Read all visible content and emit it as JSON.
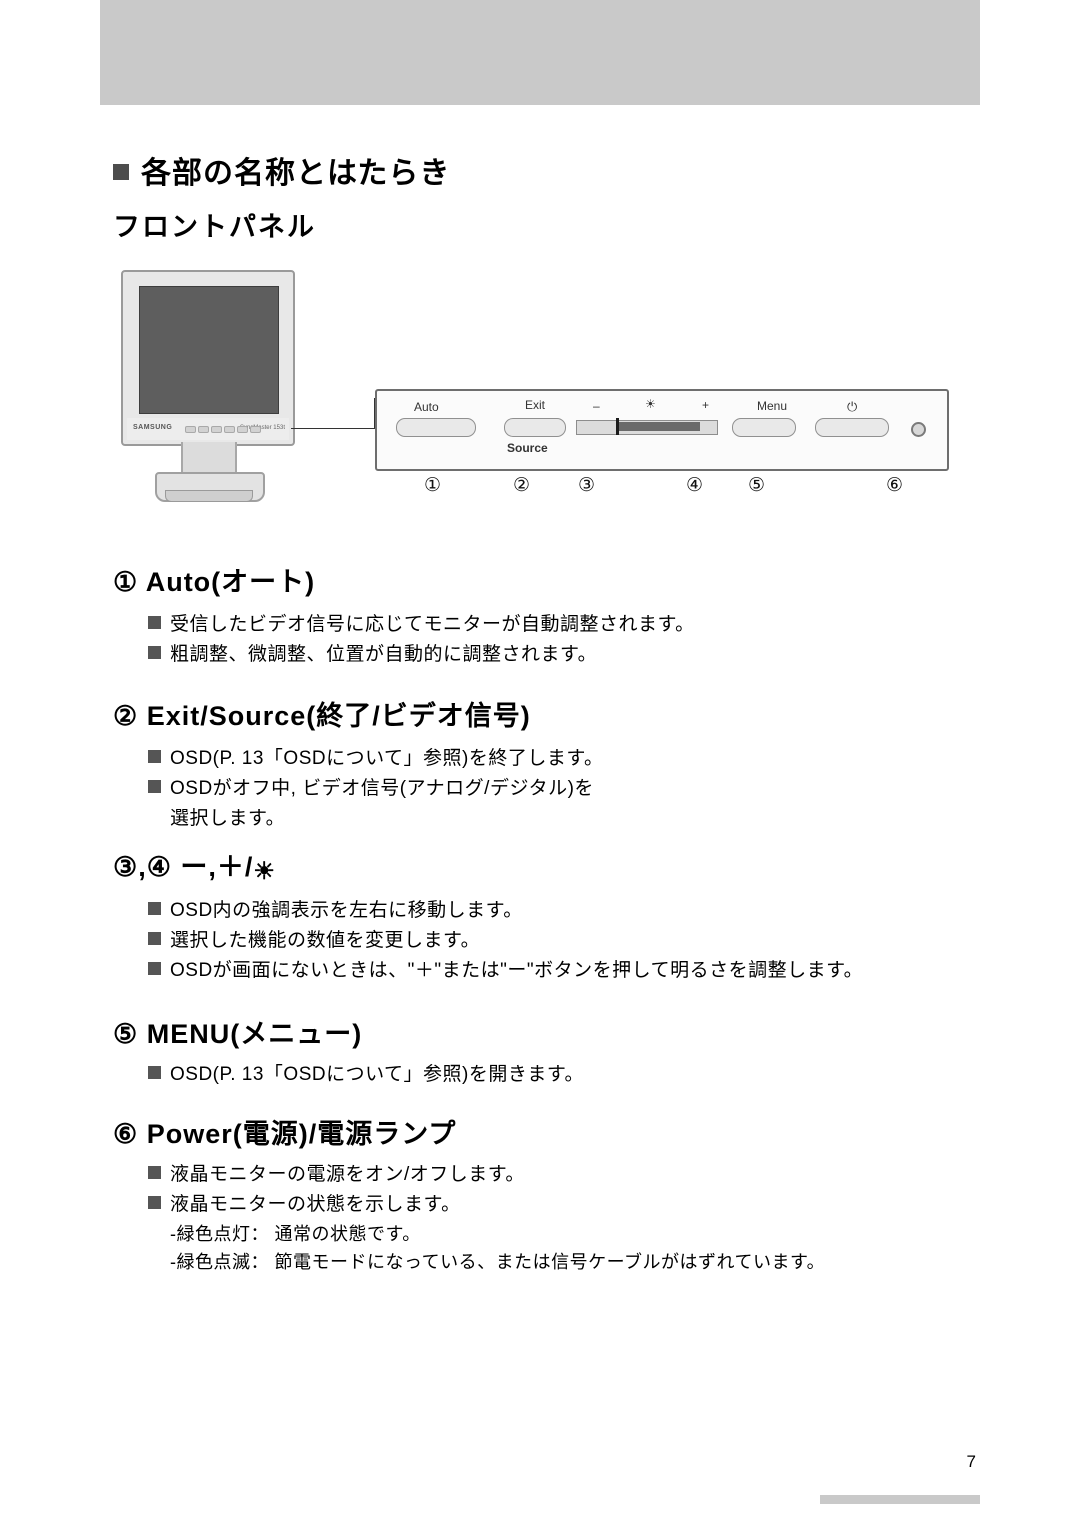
{
  "page": {
    "number": "7"
  },
  "headings": {
    "section_title": "各部の名称とはたらき",
    "sub_title": "フロントパネル"
  },
  "figure": {
    "monitor_brand": "SAMSUNG",
    "monitor_model": "SyncMaster 153t",
    "panel_labels": {
      "auto": "Auto",
      "exit": "Exit",
      "source": "Source",
      "minus": "–",
      "brightness": "☀",
      "plus": "+",
      "menu": "Menu",
      "power": "⏻"
    },
    "callout_numbers": [
      "①",
      "②",
      "③",
      "④",
      "⑤",
      "⑥"
    ]
  },
  "items": [
    {
      "heading": "① Auto(オート)",
      "bullets": [
        "受信したビデオ信号に応じてモニターが自動調整されます。",
        "粗調整、微調整、位置が自動的に調整されます。"
      ]
    },
    {
      "heading": "② Exit/Source(終了/ビデオ信号)",
      "bullets": [
        "OSD(P. 13「OSDについて」参照)を終了します。",
        "OSDがオフ中, ビデオ信号(アナログ/デジタル)を"
      ],
      "continuation": "選択します。"
    },
    {
      "heading": "③,④  ー,＋/",
      "heading_icon": "☀",
      "bullets": [
        "OSD内の強調表示を左右に移動します。",
        "選択した機能の数値を変更します。",
        "OSDが画面にないときは、\"＋\"または\"ー\"ボタンを押して明るさを調整します。"
      ]
    },
    {
      "heading": "⑤ MENU(メニュー)",
      "bullets": [
        "OSD(P. 13「OSDについて」参照)を開きます。"
      ]
    },
    {
      "heading": "⑥ Power(電源)/電源ランプ",
      "bullets": [
        "液晶モニターの電源をオン/オフします。",
        "液晶モニターの状態を示します。"
      ],
      "sub_items": [
        "‐緑色点灯： 通常の状態です。",
        "‐緑色点滅： 節電モードになっている、または信号ケーブルがはずれています。"
      ]
    }
  ]
}
